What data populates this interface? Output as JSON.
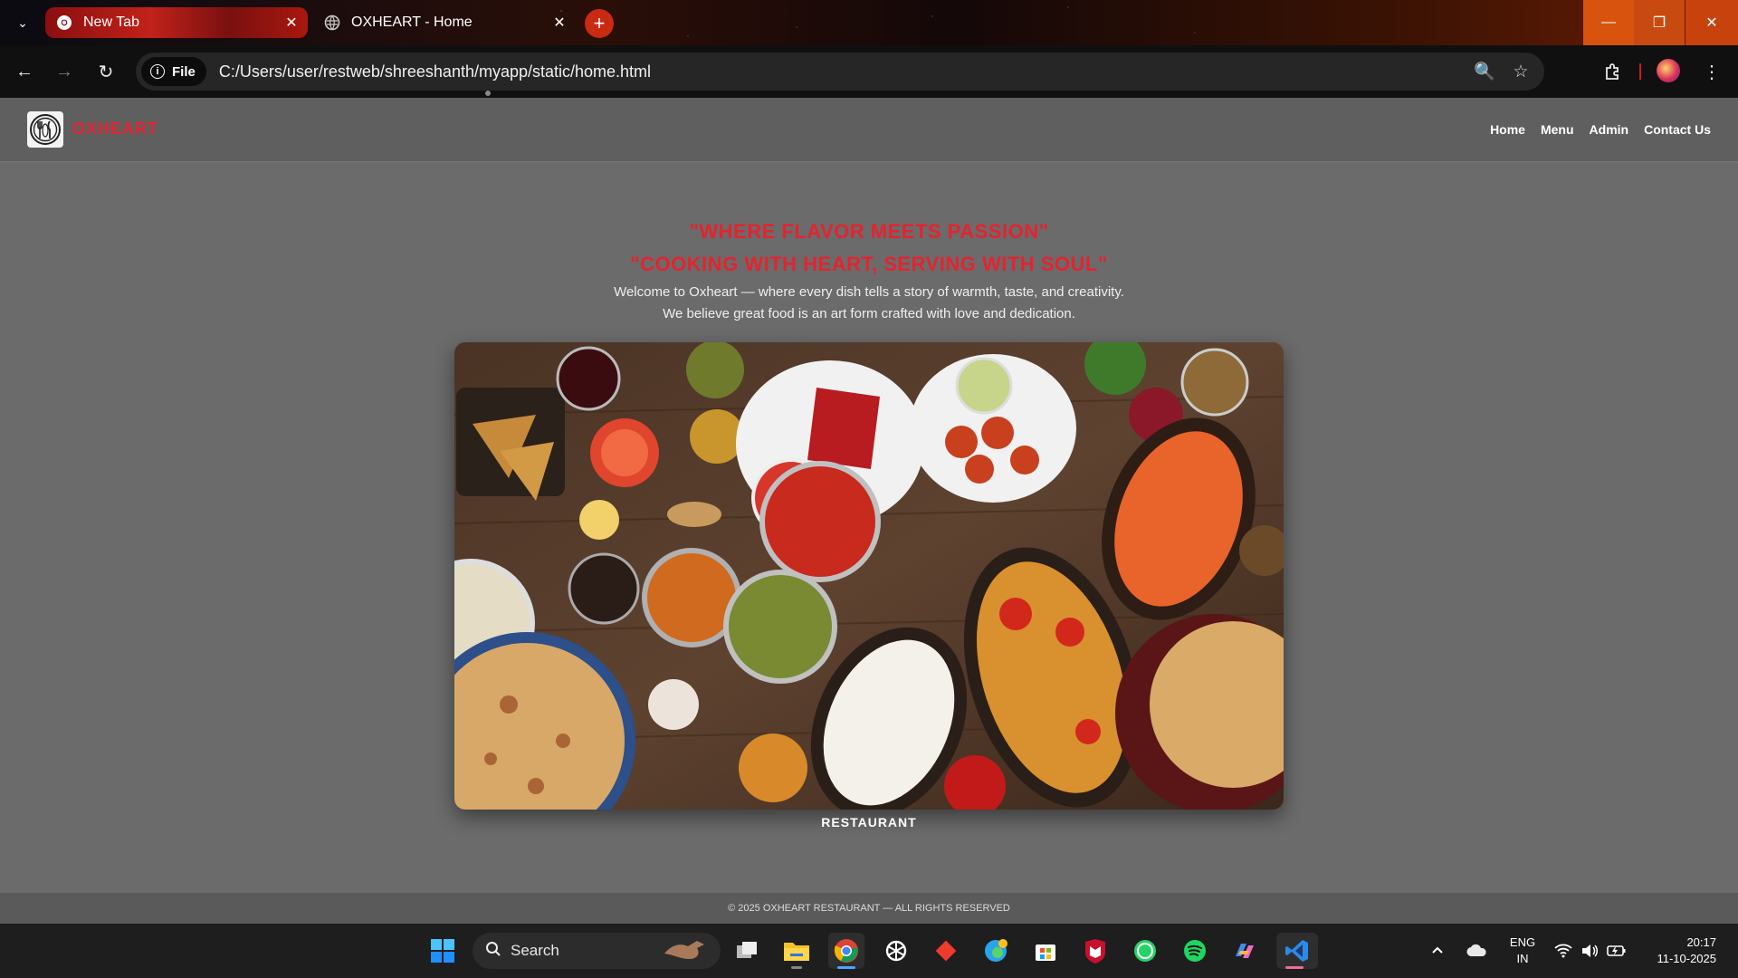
{
  "browser": {
    "tabs": [
      {
        "label": "New Tab",
        "active": true
      },
      {
        "label": "OXHEART - Home",
        "active": false
      }
    ],
    "address": {
      "chip_label": "File",
      "url": "C:/Users/user/restweb/shreeshanth/myapp/static/home.html"
    }
  },
  "site": {
    "brand": "OXHEART",
    "nav": [
      "Home",
      "Menu",
      "Admin",
      "Contact Us"
    ],
    "slogans": [
      "\"WHERE FLAVOR MEETS PASSION\"",
      "\"COOKING WITH HEART, SERVING WITH SOUL\""
    ],
    "intro": [
      "Welcome to Oxheart — where every dish tells a story of warmth, taste, and creativity.",
      "We believe great food is an art form crafted with love and dedication."
    ],
    "image_caption": "RESTAURANT",
    "footer": "© 2025 OXHEART RESTAURANT — ALL RIGHTS RESERVED"
  },
  "taskbar": {
    "search_label": "Search",
    "language": [
      "ENG",
      "IN"
    ],
    "time": "20:17",
    "date": "11-10-2025"
  },
  "colors": {
    "brand_red": "#e5232f",
    "page_bg": "#6b6b6b",
    "header_bg": "#5f5f5f"
  }
}
